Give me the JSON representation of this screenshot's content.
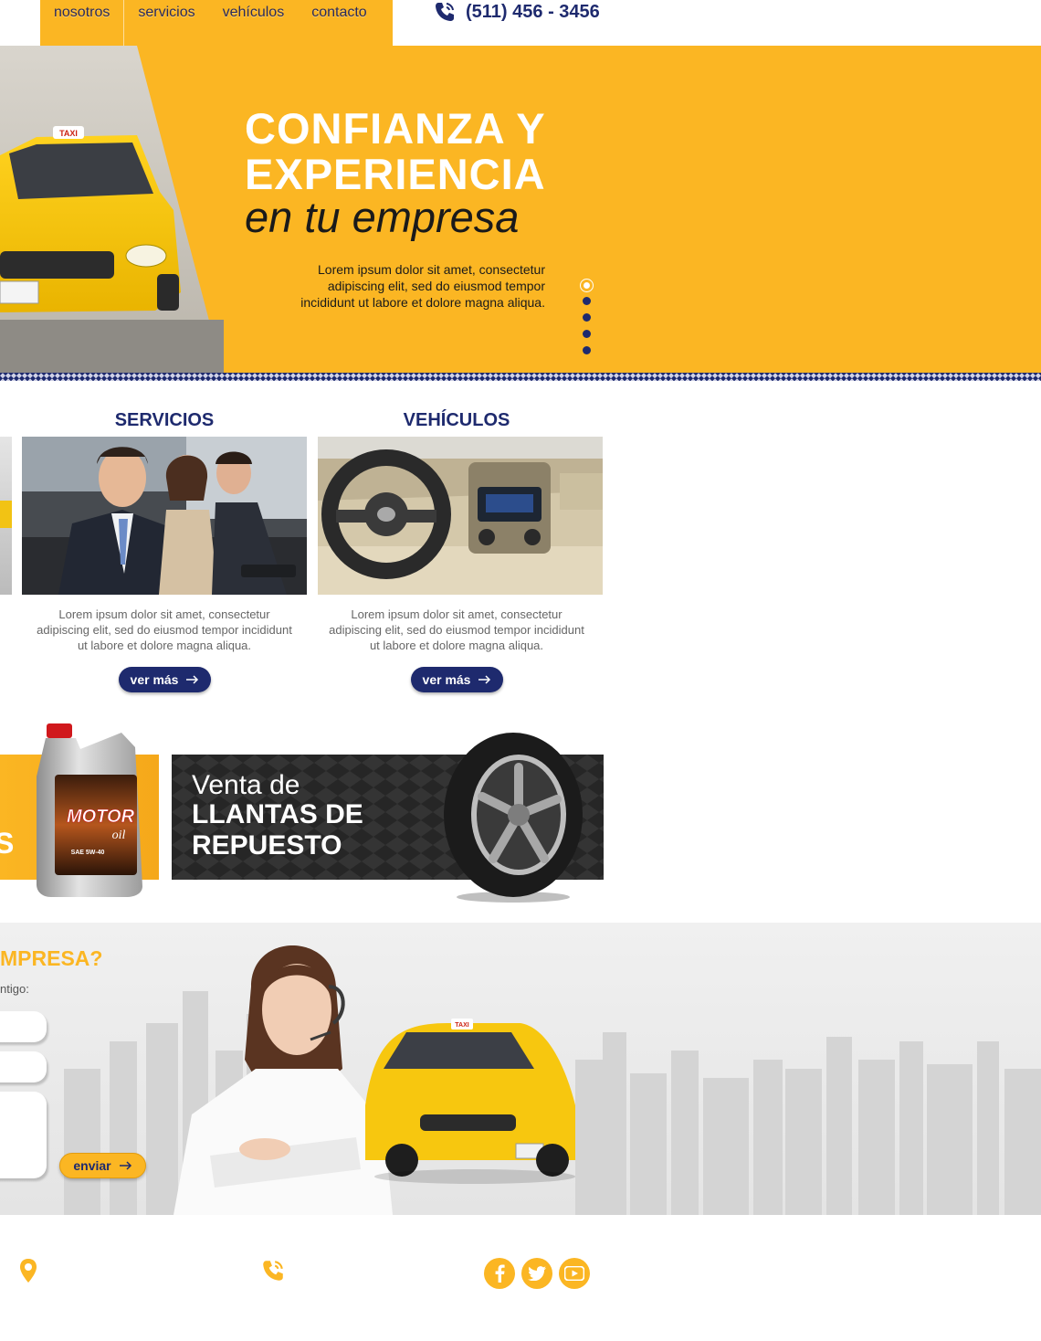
{
  "nav": {
    "items": [
      {
        "label": "nosotros"
      },
      {
        "label": "servicios"
      },
      {
        "label": "vehículos"
      },
      {
        "label": "contacto"
      }
    ],
    "phone": "(511) 456 - 3456"
  },
  "hero": {
    "title_line1": "CONFIANZA Y",
    "title_line2": "EXPERIENCIA",
    "title_line3": "en tu empresa",
    "text": "Lorem ipsum dolor sit amet, consectetur adipiscing elit, sed do eiusmod tempor incididunt ut labore et dolore magna aliqua.",
    "slides_count": 5,
    "active_slide": 1
  },
  "cards": [
    {
      "title": "SERVICIOS",
      "text": "Lorem ipsum dolor sit amet, consectetur adipiscing elit, sed do eiusmod tempor incididunt ut labore et dolore magna aliqua.",
      "button": "ver más"
    },
    {
      "title": "VEHÍCULOS",
      "text": "Lorem ipsum dolor sit amet, consectetur adipiscing elit, sed do eiusmod tempor incididunt ut labore et dolore magna aliqua.",
      "button": "ver más"
    }
  ],
  "promos": {
    "left_fragment": "S",
    "oil_brand": "MOTOR",
    "oil_sub": "oil",
    "oil_grade": "SAE 5W-40",
    "tires_line1": "Venta de",
    "tires_line2": "LLANTAS DE REPUESTO"
  },
  "contact": {
    "title": "MPRESA?",
    "subtitle": "ntigo:",
    "send_button": "enviar"
  },
  "colors": {
    "brand_yellow": "#fbb623",
    "brand_navy": "#1e2a6e"
  },
  "icons": {
    "phone": "phone-icon",
    "location": "location-pin-icon",
    "facebook": "facebook-icon",
    "twitter": "twitter-icon",
    "youtube": "youtube-icon",
    "arrow": "arrow-right-icon"
  }
}
